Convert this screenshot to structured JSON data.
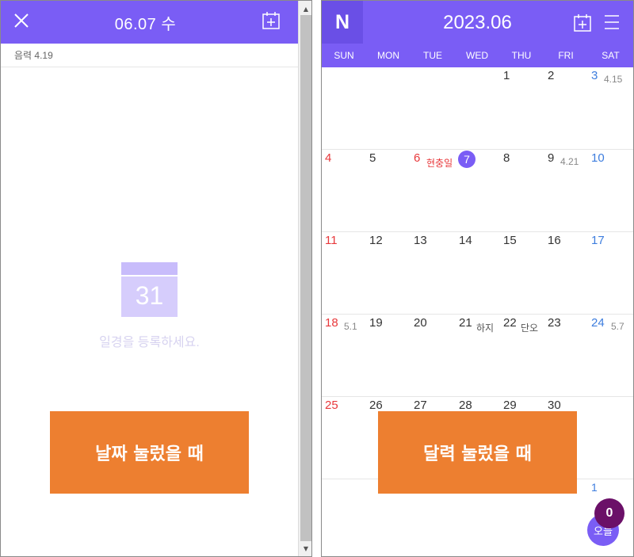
{
  "left": {
    "header_title": "06.07 수",
    "lunar_text": "음력 4.19",
    "empty_icon_number": "31",
    "empty_message": "일경을 등록하세요.",
    "overlay_label": "날짜 눌렀을 때"
  },
  "right": {
    "logo": "N",
    "title": "2023.06",
    "weekdays": [
      "SUN",
      "MON",
      "TUE",
      "WED",
      "THU",
      "FRI",
      "SAT"
    ],
    "overlay_label": "달력 눌렀을 때",
    "weeks": [
      [
        {
          "d": "",
          "s": ""
        },
        {
          "d": "",
          "s": ""
        },
        {
          "d": "",
          "s": ""
        },
        {
          "d": "",
          "s": ""
        },
        {
          "d": "1",
          "s": ""
        },
        {
          "d": "2",
          "s": ""
        },
        {
          "d": "3",
          "s": "4.15"
        }
      ],
      [
        {
          "d": "4",
          "s": ""
        },
        {
          "d": "5",
          "s": ""
        },
        {
          "d": "6",
          "s": "현충일"
        },
        {
          "d": "7",
          "s": ""
        },
        {
          "d": "8",
          "s": ""
        },
        {
          "d": "9",
          "s": "4.21"
        },
        {
          "d": "10",
          "s": ""
        }
      ],
      [
        {
          "d": "11",
          "s": ""
        },
        {
          "d": "12",
          "s": ""
        },
        {
          "d": "13",
          "s": ""
        },
        {
          "d": "14",
          "s": ""
        },
        {
          "d": "15",
          "s": ""
        },
        {
          "d": "16",
          "s": ""
        },
        {
          "d": "17",
          "s": ""
        }
      ],
      [
        {
          "d": "18",
          "s": "5.1"
        },
        {
          "d": "19",
          "s": ""
        },
        {
          "d": "20",
          "s": ""
        },
        {
          "d": "21",
          "s": "하지"
        },
        {
          "d": "22",
          "s": "단오"
        },
        {
          "d": "23",
          "s": ""
        },
        {
          "d": "24",
          "s": "5.7"
        }
      ],
      [
        {
          "d": "25",
          "s": ""
        },
        {
          "d": "26",
          "s": ""
        },
        {
          "d": "27",
          "s": ""
        },
        {
          "d": "28",
          "s": ""
        },
        {
          "d": "29",
          "s": ""
        },
        {
          "d": "30",
          "s": ""
        },
        {
          "d": "",
          "s": ""
        }
      ],
      [
        {
          "d": "",
          "s": ""
        },
        {
          "d": "",
          "s": ""
        },
        {
          "d": "",
          "s": ""
        },
        {
          "d": "",
          "s": ""
        },
        {
          "d": "",
          "s": ""
        },
        {
          "d": "",
          "s": ""
        },
        {
          "d": "1",
          "s": ""
        }
      ]
    ],
    "today_button": "오늘",
    "badge_count": "0"
  },
  "colors": {
    "header": "#7a5df5",
    "logo_bg": "#6a4fe6",
    "orange": "#ed7f30",
    "sunday_holiday": "#e8383b",
    "saturday": "#3d7dde",
    "badge": "#6b1068"
  }
}
